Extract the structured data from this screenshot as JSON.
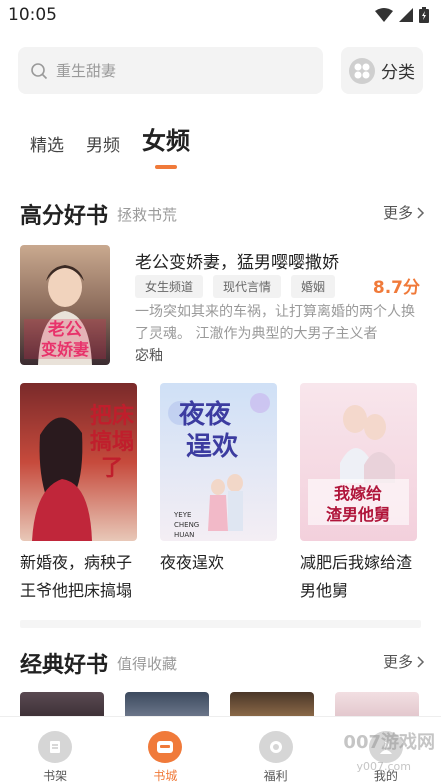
{
  "status_bar": {
    "time": "10:05"
  },
  "search": {
    "placeholder": "重生甜妻",
    "category_label": "分类"
  },
  "tabs": [
    {
      "label": "精选",
      "active": false
    },
    {
      "label": "男频",
      "active": false
    },
    {
      "label": "女频",
      "active": true
    }
  ],
  "section_high": {
    "title": "高分好书",
    "subtitle": "拯救书荒",
    "more_label": "更多",
    "featured": {
      "title": "老公变娇妻，猛男嘤嘤撒娇",
      "cover_text": "老公变娇妻",
      "tags": [
        "女生频道",
        "现代言情",
        "婚姻"
      ],
      "score": "8.7分",
      "description": "一场突如其来的车祸，让打算离婚的两个人换了灵魂。 江澈作为典型的大男子主义者",
      "author": "宓釉"
    },
    "books": [
      {
        "name": "新婚夜，病秧子王爷他把床搞塌了",
        "cover_text": "把床搞塌了"
      },
      {
        "name": "夜夜逞欢",
        "cover_text": "夜夜逞欢"
      },
      {
        "name": "减肥后我嫁给渣男他舅",
        "cover_text": "我嫁给渣男他舅"
      }
    ]
  },
  "section_classic": {
    "title": "经典好书",
    "subtitle": "值得收藏",
    "more_label": "更多"
  },
  "bottom_nav": [
    {
      "label": "书架",
      "active": false
    },
    {
      "label": "书城",
      "active": true
    },
    {
      "label": "福利",
      "active": false
    },
    {
      "label": "我的",
      "active": false
    }
  ],
  "watermark": "007游戏网",
  "watermark_url": "y007.com",
  "colors": {
    "accent": "#f07a3a"
  }
}
